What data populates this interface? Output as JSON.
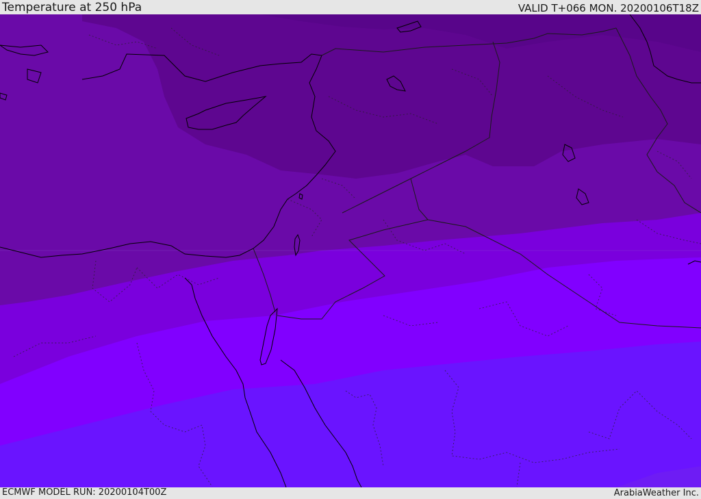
{
  "header": {
    "title": "Temperature at 250 hPa",
    "valid_time": "VALID T+066 MON. 20200106T18Z"
  },
  "footer": {
    "model_run": "ECMWF MODEL RUN: 20200104T00Z",
    "credit": "ArabiaWeather Inc."
  },
  "map": {
    "variable": "temperature",
    "pressure_level_hpa": 250,
    "palette": {
      "coldest": "#5e0690",
      "cold": "#6a0aa8",
      "mid_cold": "#7009bd",
      "mid": "#7a00dd",
      "warm": "#8100ff",
      "warmest": "#6a14ff",
      "far_edge": "#6e1cf4",
      "coastline": "#000000",
      "border": "#1a1a1a"
    }
  }
}
